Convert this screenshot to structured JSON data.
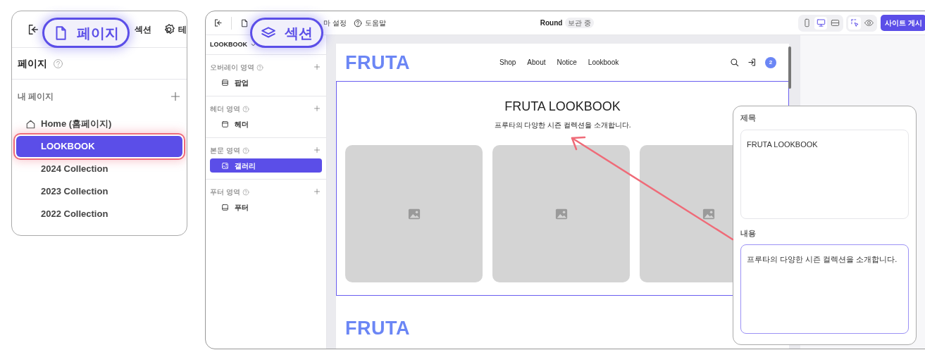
{
  "pages_panel": {
    "toolbar": [
      "섹션",
      "테"
    ],
    "title": "페이지",
    "group_label": "내 페이지",
    "pages": [
      {
        "label": "Home (홈페이지)",
        "kind": "home",
        "selected": false
      },
      {
        "label": "LOOKBOOK",
        "kind": "page",
        "selected": true
      },
      {
        "label": "2024 Collection",
        "kind": "page",
        "selected": false
      },
      {
        "label": "2023 Collection",
        "kind": "page",
        "selected": false
      },
      {
        "label": "2022 Collection",
        "kind": "page",
        "selected": false
      }
    ]
  },
  "callouts": [
    "페이지",
    "섹션"
  ],
  "editor": {
    "toolbar": [
      "마 설정",
      "도움말"
    ],
    "site_name": "Round",
    "status": "보관 중",
    "view_modes": [
      {
        "selected": false
      },
      {
        "selected": true
      },
      {
        "selected": false
      }
    ],
    "tools": [
      {
        "selected": true
      },
      {
        "selected": false
      }
    ],
    "publish_button": "사이트 게시",
    "page_select": "LOOKBOOK",
    "areas": [
      {
        "label": "오버레이 영역",
        "blocks": [
          {
            "label": "팝업",
            "selected": false
          }
        ]
      },
      {
        "label": "헤더 영역",
        "blocks": [
          {
            "label": "헤더",
            "selected": false
          }
        ]
      },
      {
        "label": "본문 영역",
        "blocks": [
          {
            "label": "갤러리",
            "selected": true
          }
        ]
      },
      {
        "label": "푸터 영역",
        "blocks": [
          {
            "label": "푸터",
            "selected": false
          }
        ]
      }
    ],
    "preview": {
      "logo": "FRUTA",
      "nav": [
        "Shop",
        "About",
        "Notice",
        "Lookbook"
      ],
      "cart_count": "2",
      "section": {
        "title": "FRUTA LOOKBOOK",
        "subtitle": "프루타의 다양한 시즌 컬렉션을 소개합니다.",
        "gallery": [
          {
            "kind": "placeholder"
          },
          {
            "kind": "placeholder"
          },
          {
            "kind": "placeholder"
          }
        ]
      },
      "footer_logo": "FRUTA"
    }
  },
  "section_editor": {
    "fields": [
      {
        "label": "제목",
        "value": "FRUTA LOOKBOOK",
        "focused": false
      },
      {
        "label": "내용",
        "value": "프루타의 다양한 시즌 컬렉션을 소개합니다.",
        "focused": true
      }
    ]
  }
}
